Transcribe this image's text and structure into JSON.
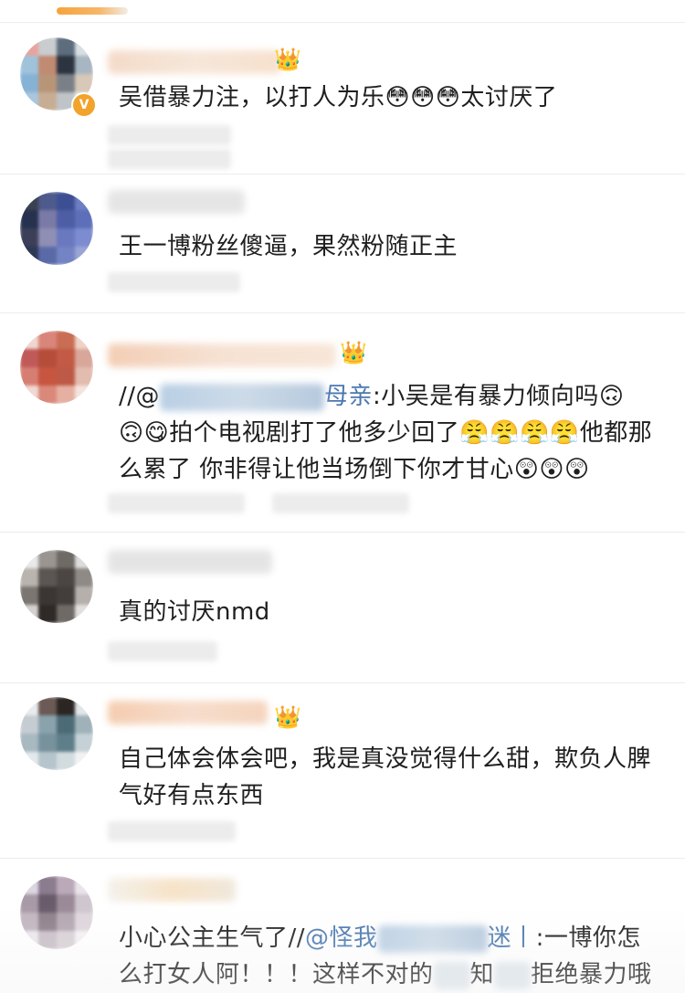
{
  "comments": [
    {
      "segments": [
        "吴借暴力注，以打人为乐",
        "😳😳😳",
        "太讨厌了"
      ]
    },
    {
      "segments": [
        "王一博粉丝傻逼，果然粉随正主"
      ]
    },
    {
      "segments": [
        "//@",
        "母亲",
        ":小吴是有暴力倾向吗",
        "🙃",
        "🙃😋",
        "拍个电视剧打了他多少回了",
        "😤😤😤😤",
        "他都那么累了 你非得让他当场倒下你才甘心",
        "😲😲😲"
      ]
    },
    {
      "segments": [
        "真的讨厌nmd"
      ]
    },
    {
      "segments": [
        "自己体会体会吧，我是真没觉得什么甜，欺负人脾气好有点东西"
      ]
    },
    {
      "segments": [
        "小心公主生气了//",
        "@怪我",
        "迷丨",
        ":一博你怎么打女人阿！！！这样不对的",
        "知",
        "拒绝暴力哦"
      ]
    }
  ],
  "icons": {
    "crown": "👑",
    "verified": "V"
  },
  "colors": {
    "mention": "#4a78b0",
    "tab_indicator": "#f7a33a",
    "verified_badge": "#f1a32b"
  }
}
